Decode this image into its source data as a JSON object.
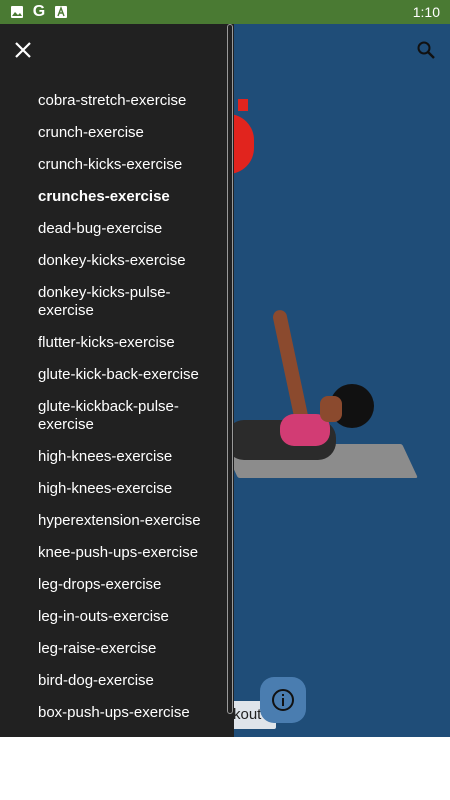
{
  "status_bar": {
    "time": "1:10",
    "icons": [
      "image-icon",
      "google-icon",
      "text-icon"
    ],
    "google_letter": "G",
    "bg_color": "#4a7a33"
  },
  "app": {
    "bg_color": "#1f4d78",
    "workout_label": "rkout",
    "icons": {
      "search": "search-icon",
      "info": "info-icon"
    }
  },
  "drawer": {
    "close_icon": "close-icon",
    "selected_index": 3,
    "items": [
      "cobra-stretch-exercise",
      "crunch-exercise",
      "crunch-kicks-exercise",
      "crunches-exercise",
      "dead-bug-exercise",
      "donkey-kicks-exercise",
      "donkey-kicks-pulse-exercise",
      "flutter-kicks-exercise",
      "glute-kick-back-exercise",
      "glute-kickback-pulse-exercise",
      "high-knees-exercise",
      "high-knees-exercise",
      "hyperextension-exercise",
      "knee-push-ups-exercise",
      "leg-drops-exercise",
      "leg-in-outs-exercise",
      "leg-raise-exercise",
      "bird-dog-exercise",
      "box-push-ups-exercise"
    ]
  }
}
